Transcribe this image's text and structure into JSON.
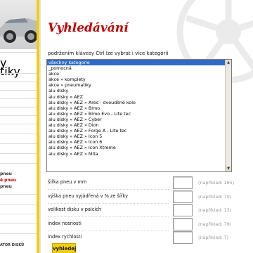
{
  "sidebar": {
    "link_y": "y",
    "link_tiky": "tiky",
    "pneu_1": "pneu",
    "pneu_2": "ě pneu",
    "pneu_3": "pneu",
    "bottom_label": "ATOR DISKŮ"
  },
  "page": {
    "title": "Vyhledávání",
    "hint": "podržením klávesy Ctrl lze vybrat i více kategorií"
  },
  "categories": [
    "všechny kategorie",
    "_pomocná",
    "akce",
    "akce » komplety",
    "akce » pneumatiky",
    "alu disky",
    "alu disky » AEZ",
    "alu disky » AEZ » Ares - dvoudílné kolo",
    "alu disky » AEZ » Bimo",
    "alu disky » AEZ » Bimo Evo - Lite tec",
    "alu disky » AEZ » Cyber",
    "alu disky » AEZ » Dion",
    "alu disky » AEZ » Forge A - Lite tec",
    "alu disky » AEZ » Icon 5",
    "alu disky » AEZ » Icon 6",
    "alu disky » AEZ » Icon Xtreme",
    "alu disky » AEZ » Mita"
  ],
  "fields": [
    {
      "label": "šířka pneu v mm",
      "hint": "(například: 165)"
    },
    {
      "label": "výška pneu vyjádřená v % ze šířky",
      "hint": "(například: 70)"
    },
    {
      "label": "velikost disku v palcích",
      "hint": "(například: 13)"
    },
    {
      "label": "index nosnosti",
      "hint": "(například: 79)"
    },
    {
      "label": "index rychlosti",
      "hint": "(například: T)"
    }
  ],
  "search_button": "vyhledej",
  "colors": {
    "accent_yellow": "#f2cf0e",
    "title_red": "#c00000",
    "selection_blue": "#316ac5"
  }
}
